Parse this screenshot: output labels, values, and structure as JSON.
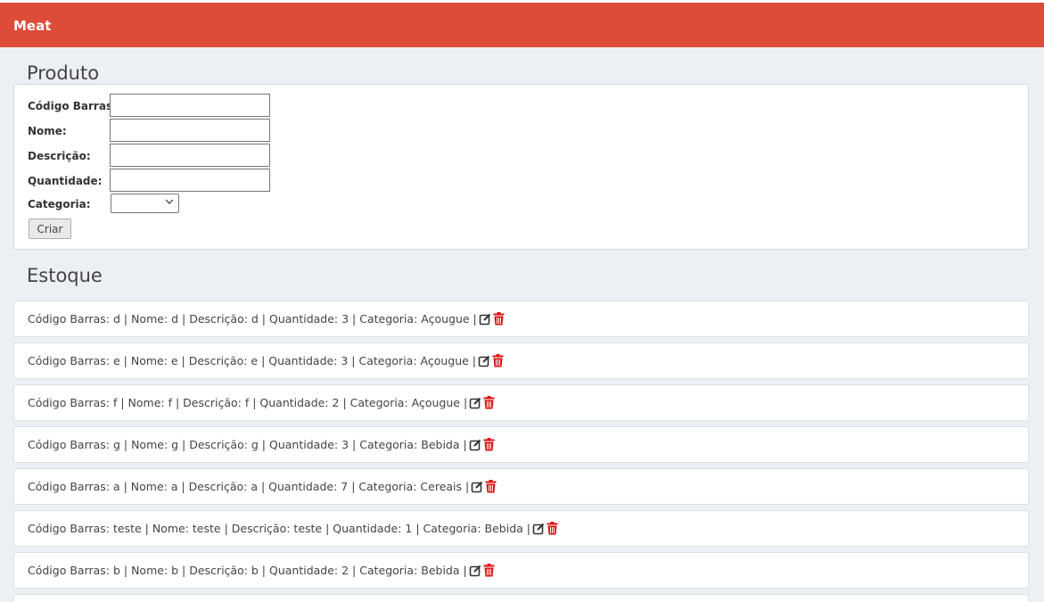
{
  "navbar": {
    "brand": "Meat"
  },
  "produto": {
    "title": "Produto",
    "fields": [
      {
        "label": "Código Barras:",
        "value": ""
      },
      {
        "label": "Nome:",
        "value": ""
      },
      {
        "label": "Descrição:",
        "value": ""
      },
      {
        "label": "Quantidade:",
        "value": ""
      }
    ],
    "categoria": {
      "label": "Categoria:",
      "selected": ""
    },
    "submit_label": "Criar"
  },
  "estoque": {
    "title": "Estoque",
    "items": [
      {
        "text": "Código Barras: d | Nome: d | Descrição: d | Quantidade: 3 | Categoria: Açougue |"
      },
      {
        "text": "Código Barras: e | Nome: e | Descrição: e | Quantidade: 3 | Categoria: Açougue |"
      },
      {
        "text": "Código Barras: f | Nome: f | Descrição: f | Quantidade: 2 | Categoria: Açougue |"
      },
      {
        "text": "Código Barras: g | Nome: g | Descrição: g | Quantidade: 3 | Categoria: Bebida |"
      },
      {
        "text": "Código Barras: a | Nome: a | Descrição: a | Quantidade: 7 | Categoria: Cereais |"
      },
      {
        "text": "Código Barras: teste | Nome: teste | Descrição: teste | Quantidade: 1 | Categoria: Bebida |"
      },
      {
        "text": "Código Barras: b | Nome: b | Descrição: b | Quantidade: 2 | Categoria: Bebida |"
      },
      {
        "text": ""
      }
    ],
    "icons": {
      "edit": "edit-icon",
      "delete": "trash-icon"
    }
  },
  "colors": {
    "navbar": "#dd4b39",
    "background": "#ecf0f5",
    "delete_icon": "#dd1111",
    "edit_icon": "#333333"
  }
}
